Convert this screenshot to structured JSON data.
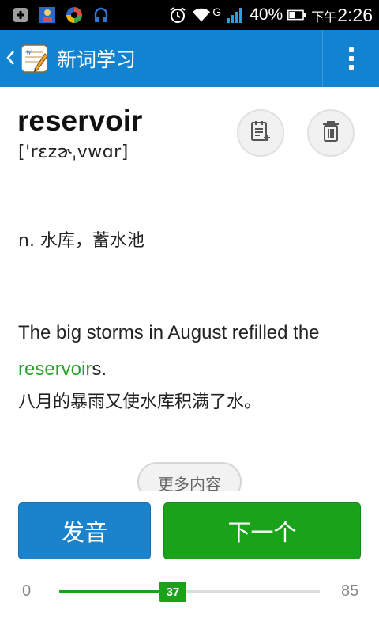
{
  "status_bar": {
    "battery": "40%",
    "time_prefix": "下午",
    "time": "2:26",
    "network": "G"
  },
  "app_bar": {
    "title": "新词学习"
  },
  "word": {
    "text": "reservoir",
    "phonetic": "['rɛzɚˌvwɑr]",
    "definition": "n. 水库，蓄水池"
  },
  "example": {
    "en_before": "The big storms in August refilled the ",
    "en_highlight": "reservoir",
    "en_after": "s.",
    "zh": "八月的暴雨又使水库积满了水。"
  },
  "more_button": "更多内容",
  "actions": {
    "pronounce": "发音",
    "next": "下一个"
  },
  "progress": {
    "min": "0",
    "max": "85",
    "current": "37",
    "current_value": 37,
    "max_value": 85
  },
  "colors": {
    "app_bar": "#1283d0",
    "accent_green": "#1ba21b",
    "accent_blue": "#1b82cc"
  },
  "icons": {
    "note_add": "note-add-icon",
    "delete": "trash-icon",
    "overflow": "overflow-menu-icon",
    "back": "back-chevron-icon"
  }
}
